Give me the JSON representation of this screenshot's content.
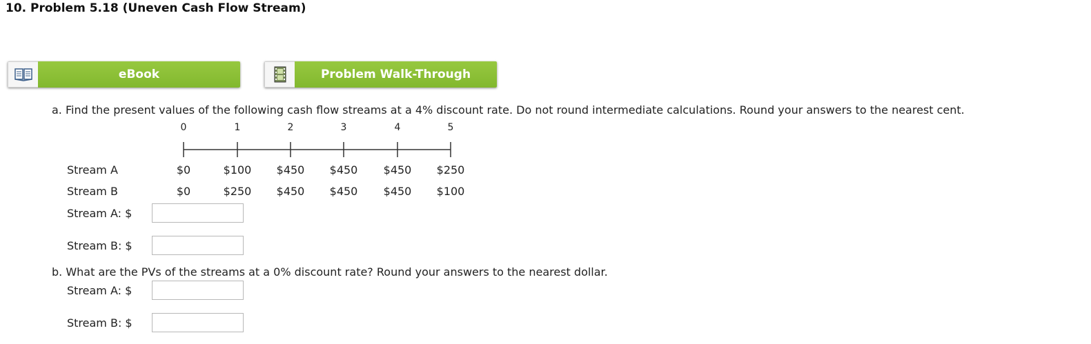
{
  "header": {
    "title": "10.  Problem 5.18 (Uneven Cash Flow Stream)"
  },
  "resources": {
    "ebook_label": "eBook",
    "walkthrough_label": "Problem Walk-Through"
  },
  "part_a": {
    "prompt": "a. Find the present values of the following cash flow streams at a 4% discount rate. Do not round intermediate calculations. Round your answers to the nearest cent.",
    "periods": [
      "0",
      "1",
      "2",
      "3",
      "4",
      "5"
    ],
    "streams": [
      {
        "name": "Stream A",
        "values": [
          "$0",
          "$100",
          "$450",
          "$450",
          "$450",
          "$250"
        ]
      },
      {
        "name": "Stream B",
        "values": [
          "$0",
          "$250",
          "$450",
          "$450",
          "$450",
          "$100"
        ]
      }
    ],
    "answers": [
      {
        "label": "Stream A: $",
        "value": ""
      },
      {
        "label": "Stream B: $",
        "value": ""
      }
    ]
  },
  "part_b": {
    "prompt": "b. What are the PVs of the streams at a 0% discount rate? Round your answers to the nearest dollar.",
    "answers": [
      {
        "label": "Stream A: $",
        "value": ""
      },
      {
        "label": "Stream B: $",
        "value": ""
      }
    ]
  },
  "colors": {
    "button_green": "#8cc13b",
    "text": "#222222"
  }
}
